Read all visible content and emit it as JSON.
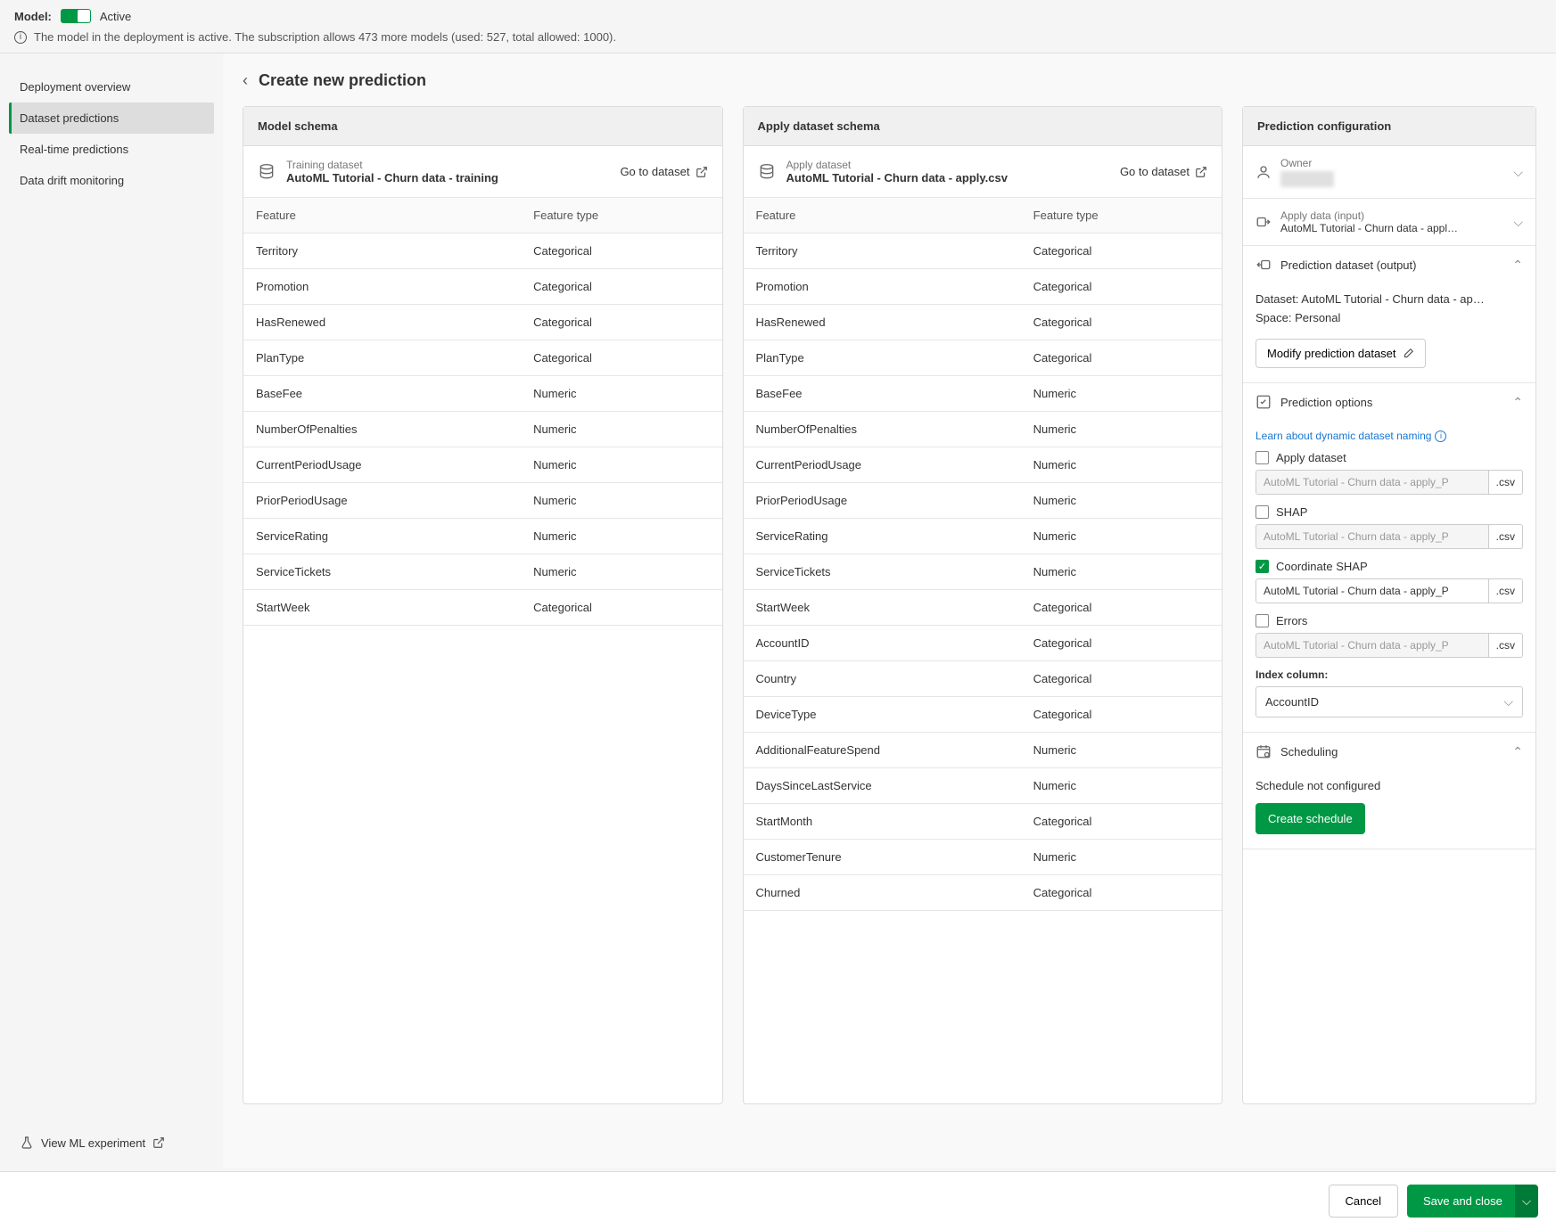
{
  "banner": {
    "model_label": "Model:",
    "status": "Active",
    "info_text": "The model in the deployment is active. The subscription allows 473 more models (used: 527, total allowed: 1000)."
  },
  "sidebar": {
    "items": [
      {
        "label": "Deployment overview"
      },
      {
        "label": "Dataset predictions"
      },
      {
        "label": "Real-time predictions"
      },
      {
        "label": "Data drift monitoring"
      }
    ],
    "footer": "View ML experiment"
  },
  "page": {
    "title": "Create new prediction"
  },
  "model_schema": {
    "title": "Model schema",
    "dataset_label": "Training dataset",
    "dataset_name": "AutoML Tutorial - Churn data - training",
    "goto": "Go to dataset",
    "col_feature": "Feature",
    "col_type": "Feature type",
    "rows": [
      {
        "feature": "Territory",
        "type": "Categorical"
      },
      {
        "feature": "Promotion",
        "type": "Categorical"
      },
      {
        "feature": "HasRenewed",
        "type": "Categorical"
      },
      {
        "feature": "PlanType",
        "type": "Categorical"
      },
      {
        "feature": "BaseFee",
        "type": "Numeric"
      },
      {
        "feature": "NumberOfPenalties",
        "type": "Numeric"
      },
      {
        "feature": "CurrentPeriodUsage",
        "type": "Numeric"
      },
      {
        "feature": "PriorPeriodUsage",
        "type": "Numeric"
      },
      {
        "feature": "ServiceRating",
        "type": "Numeric"
      },
      {
        "feature": "ServiceTickets",
        "type": "Numeric"
      },
      {
        "feature": "StartWeek",
        "type": "Categorical"
      }
    ]
  },
  "apply_schema": {
    "title": "Apply dataset schema",
    "dataset_label": "Apply dataset",
    "dataset_name": "AutoML Tutorial - Churn data - apply.csv",
    "goto": "Go to dataset",
    "col_feature": "Feature",
    "col_type": "Feature type",
    "rows": [
      {
        "feature": "Territory",
        "type": "Categorical"
      },
      {
        "feature": "Promotion",
        "type": "Categorical"
      },
      {
        "feature": "HasRenewed",
        "type": "Categorical"
      },
      {
        "feature": "PlanType",
        "type": "Categorical"
      },
      {
        "feature": "BaseFee",
        "type": "Numeric"
      },
      {
        "feature": "NumberOfPenalties",
        "type": "Numeric"
      },
      {
        "feature": "CurrentPeriodUsage",
        "type": "Numeric"
      },
      {
        "feature": "PriorPeriodUsage",
        "type": "Numeric"
      },
      {
        "feature": "ServiceRating",
        "type": "Numeric"
      },
      {
        "feature": "ServiceTickets",
        "type": "Numeric"
      },
      {
        "feature": "StartWeek",
        "type": "Categorical"
      },
      {
        "feature": "AccountID",
        "type": "Categorical"
      },
      {
        "feature": "Country",
        "type": "Categorical"
      },
      {
        "feature": "DeviceType",
        "type": "Categorical"
      },
      {
        "feature": "AdditionalFeatureSpend",
        "type": "Numeric"
      },
      {
        "feature": "DaysSinceLastService",
        "type": "Numeric"
      },
      {
        "feature": "StartMonth",
        "type": "Categorical"
      },
      {
        "feature": "CustomerTenure",
        "type": "Numeric"
      },
      {
        "feature": "Churned",
        "type": "Categorical"
      }
    ]
  },
  "config": {
    "title": "Prediction configuration",
    "owner_label": "Owner",
    "apply_data_label": "Apply data (input)",
    "apply_data_value": "AutoML Tutorial - Churn data - appl…",
    "output": {
      "title": "Prediction dataset (output)",
      "dataset_line": "Dataset: AutoML Tutorial - Churn data - ap…",
      "space_line": "Space: Personal",
      "modify_btn": "Modify prediction dataset"
    },
    "options": {
      "title": "Prediction options",
      "learn_link": "Learn about dynamic dataset naming",
      "ext": ".csv",
      "opts": [
        {
          "label": "Apply dataset",
          "checked": false,
          "value": "AutoML Tutorial - Churn data - apply_P"
        },
        {
          "label": "SHAP",
          "checked": false,
          "value": "AutoML Tutorial - Churn data - apply_P"
        },
        {
          "label": "Coordinate SHAP",
          "checked": true,
          "value": "AutoML Tutorial - Churn data - apply_P"
        },
        {
          "label": "Errors",
          "checked": false,
          "value": "AutoML Tutorial - Churn data - apply_P"
        }
      ],
      "index_label": "Index column:",
      "index_value": "AccountID"
    },
    "schedule": {
      "title": "Scheduling",
      "text": "Schedule not configured",
      "btn": "Create schedule"
    }
  },
  "footer": {
    "cancel": "Cancel",
    "save": "Save and close"
  }
}
